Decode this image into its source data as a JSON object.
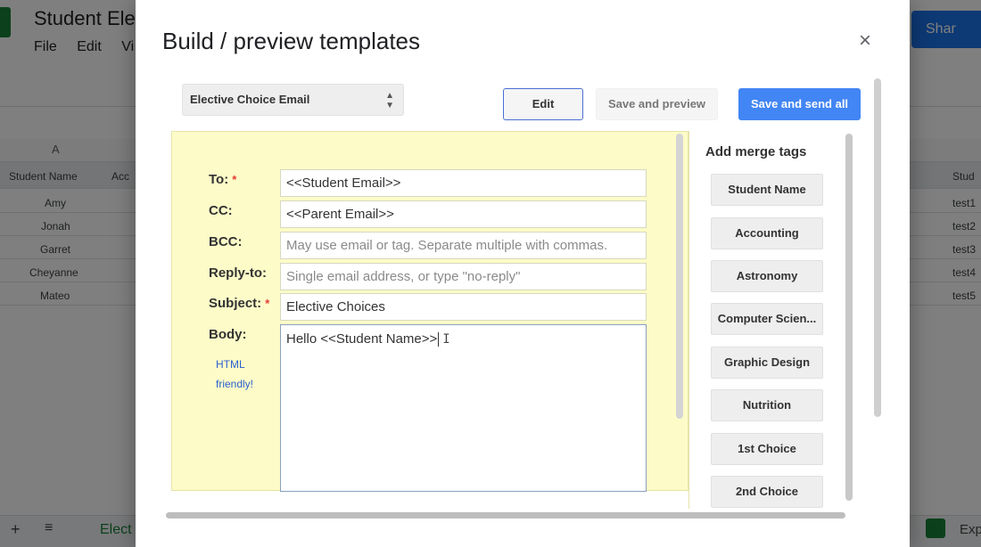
{
  "background": {
    "sheet_title": "Student Ele",
    "menu": [
      "File",
      "Edit",
      "Vi"
    ],
    "share_label": "Shar",
    "column_letter": "A",
    "headers": {
      "student_name": "Student Name",
      "second": "Acc",
      "right": "Stud"
    },
    "rows": [
      {
        "name": "Amy",
        "right": "test1"
      },
      {
        "name": "Jonah",
        "right": "test2"
      },
      {
        "name": "Garret",
        "right": "test3"
      },
      {
        "name": "Cheyanne",
        "right": "test4"
      },
      {
        "name": "Mateo",
        "right": "test5"
      }
    ],
    "sheet_tab": "Elect",
    "explore_label": "Exp"
  },
  "dialog": {
    "title": "Build / preview templates",
    "close_glyph": "×",
    "template_select": {
      "value": "Elective Choice Email"
    },
    "buttons": {
      "edit": "Edit",
      "save_preview": "Save and preview",
      "save_send": "Save and send all"
    },
    "form": {
      "to": {
        "label": "To:",
        "required": "*",
        "value": "<<Student Email>>"
      },
      "cc": {
        "label": "CC:",
        "value": "<<Parent Email>>"
      },
      "bcc": {
        "label": "BCC:",
        "placeholder": "May use email or tag. Separate multiple with commas."
      },
      "reply_to": {
        "label": "Reply-to:",
        "placeholder": "Single email address, or type \"no-reply\""
      },
      "subject": {
        "label": "Subject:",
        "required": "*",
        "value": "Elective Choices"
      },
      "body": {
        "label": "Body:",
        "value": "Hello  <<Student Name>>",
        "note_line1": "HTML",
        "note_line2": "friendly!"
      }
    },
    "merge_tags": {
      "title": "Add merge tags",
      "tags": [
        "Student Name",
        "Accounting",
        "Astronomy",
        "Computer Scien...",
        "Graphic Design",
        "Nutrition",
        "1st Choice",
        "2nd Choice"
      ]
    }
  }
}
